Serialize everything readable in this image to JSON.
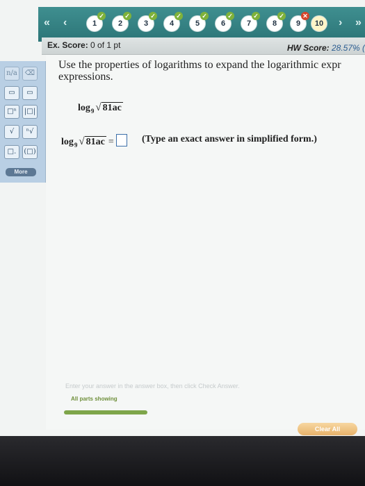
{
  "nav": {
    "questions": [
      {
        "number": "1",
        "status": "correct"
      },
      {
        "number": "2",
        "status": "correct"
      },
      {
        "number": "3",
        "status": "correct"
      },
      {
        "number": "4",
        "status": "correct"
      },
      {
        "number": "5",
        "status": "correct"
      },
      {
        "number": "6",
        "status": "correct"
      },
      {
        "number": "7",
        "status": "correct"
      },
      {
        "number": "8",
        "status": "correct"
      },
      {
        "number": "9",
        "status": "incorrect"
      },
      {
        "number": "10",
        "status": "current"
      }
    ],
    "colors": {
      "bar": "#2f7b7d",
      "correct": "#7fb23a",
      "incorrect": "#d6452b"
    }
  },
  "score": {
    "ex_label": "Ex. Score:",
    "ex_value": "0 of 1 pt",
    "hw_label": "HW Score:",
    "hw_value": "28.57% ("
  },
  "palette": {
    "tools": [
      "n/a",
      "template-1",
      "template-2",
      "template-3",
      "template-4",
      "template-5",
      "sqrt",
      "nth-root",
      "template-6",
      "template-7"
    ],
    "more_label": "More"
  },
  "question": {
    "instruction": "Use the properties of logarithms to expand the logarithmic expr expressions.",
    "expression": {
      "func": "log",
      "base": "9",
      "radicand": "81ac"
    },
    "equals": "=",
    "hint": "(Type an exact answer in simplified form.)"
  },
  "footer": {
    "hint": "Enter your answer in the answer box, then click Check Answer.",
    "parts": "All parts showing",
    "clear_label": "Clear All"
  }
}
